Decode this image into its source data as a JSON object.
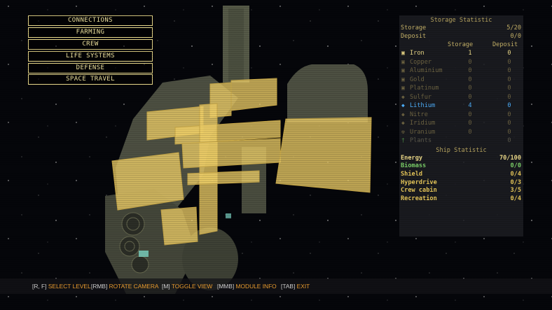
{
  "menu": {
    "items": [
      "CONNECTIONS",
      "FARMING",
      "CREW",
      "LIFE SYSTEMS",
      "DEFENSE",
      "SPACE TRAVEL"
    ]
  },
  "storage": {
    "title": "Storage Statistic",
    "storage_label": "Storage",
    "storage_value": "5/20",
    "deposit_label": "Deposit",
    "deposit_value": "0/0",
    "col_storage": "Storage",
    "col_deposit": "Deposit",
    "resources": [
      {
        "name": "Iron",
        "storage": "1",
        "deposit": "0",
        "icon": "ore-icon"
      },
      {
        "name": "Copper",
        "storage": "0",
        "deposit": "0",
        "icon": "ore-icon"
      },
      {
        "name": "Aluminium",
        "storage": "0",
        "deposit": "0",
        "icon": "ore-icon"
      },
      {
        "name": "Gold",
        "storage": "0",
        "deposit": "0",
        "icon": "ore-icon"
      },
      {
        "name": "Platinum",
        "storage": "0",
        "deposit": "0",
        "icon": "ore-icon"
      },
      {
        "name": "Sulfur",
        "storage": "0",
        "deposit": "0",
        "icon": "crystal-icon"
      },
      {
        "name": "Lithium",
        "storage": "4",
        "deposit": "0",
        "icon": "crystal-icon"
      },
      {
        "name": "Nitre",
        "storage": "0",
        "deposit": "0",
        "icon": "crystal-icon"
      },
      {
        "name": "Iridium",
        "storage": "0",
        "deposit": "0",
        "icon": "crystal-icon"
      },
      {
        "name": "Uranium",
        "storage": "0",
        "deposit": "0",
        "icon": "radiation-icon"
      },
      {
        "name": "Plants",
        "storage": "",
        "deposit": "0",
        "icon": "plant-icon"
      }
    ]
  },
  "ship": {
    "title": "Ship Statistic",
    "stats": [
      {
        "label": "Energy",
        "value": "70/100"
      },
      {
        "label": "Biomass",
        "value": "0/0"
      },
      {
        "label": "Shield",
        "value": "0/4"
      },
      {
        "label": "Hyperdrive",
        "value": "0/3"
      },
      {
        "label": "Crew cabin",
        "value": "3/5"
      },
      {
        "label": "Recreation",
        "value": "0/4"
      }
    ]
  },
  "hints": [
    {
      "key": "[R, F]",
      "action": "SELECT LEVEL"
    },
    {
      "key": "[RMB]",
      "action": "ROTATE CAMERA"
    },
    {
      "key": "[M]",
      "action": "TOGGLE VIEW"
    },
    {
      "key": "[MMB]",
      "action": "MODULE INFO"
    },
    {
      "key": "[TAB]",
      "action": "EXIT"
    }
  ],
  "colors": {
    "accent": "#f2e6a0",
    "action": "#f0a030",
    "lithium": "#4fb2ff",
    "ship_green": "#7dd36a",
    "ship_gold": "#e8c85a"
  }
}
